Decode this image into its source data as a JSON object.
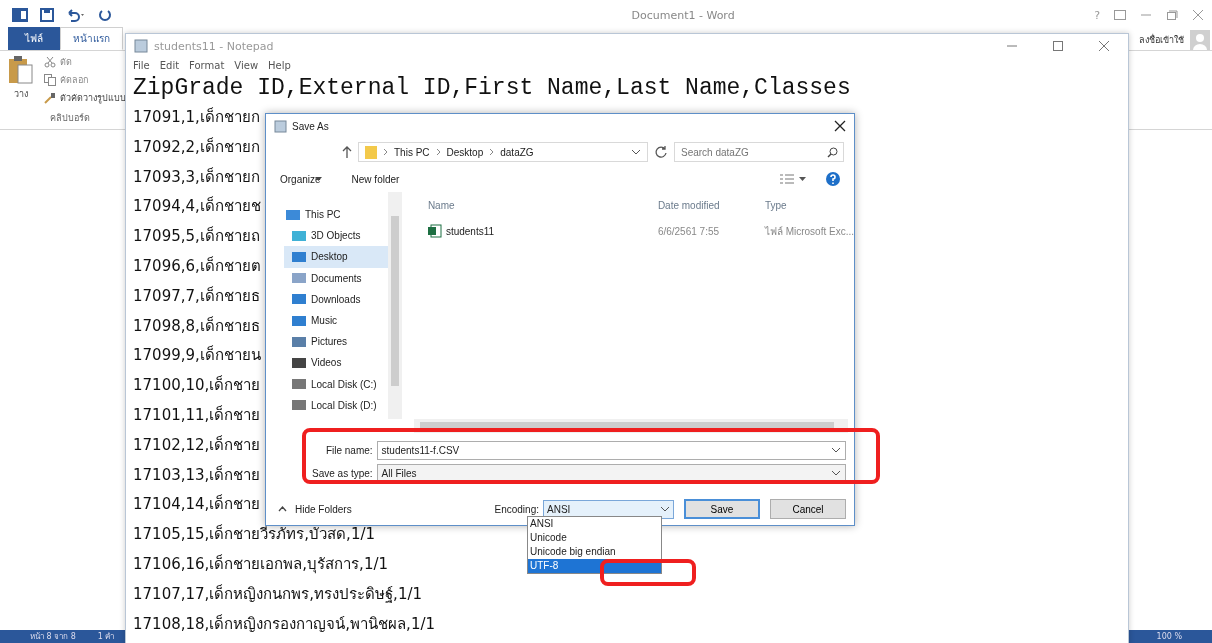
{
  "word": {
    "title": "Document1 - Word",
    "help": "?",
    "sign_in": "ลงชื่อเข้าใช้",
    "tabs": [
      {
        "label": "ไฟล์",
        "kind": "file",
        "selected": false
      },
      {
        "label": "หน้าแรก",
        "kind": "tab",
        "selected": true
      }
    ],
    "clipboard": {
      "paste": "วาง",
      "cut": "ตัด",
      "copy": "คัดลอก",
      "format_painter": "ตัวคัดวางรูปแบบ",
      "group_label": "คลิปบอร์ด"
    },
    "status_bar": {
      "page": "หน้า 8 จาก 8",
      "words": "1 คำ",
      "zoom": "100 %"
    }
  },
  "notepad": {
    "title": "students11 - Notepad",
    "menu": [
      "File",
      "Edit",
      "Format",
      "View",
      "Help"
    ],
    "header": "ZipGrade ID,External ID,First Name,Last Name,Classes",
    "lines": [
      "17091,1,เด็กชายก",
      "17092,2,เด็กชายก",
      "17093,3,เด็กชายก",
      "17094,4,เด็กชายช",
      "17095,5,เด็กชายถ",
      "17096,6,เด็กชายต",
      "17097,7,เด็กชายธ",
      "17098,8,เด็กชายธ",
      "17099,9,เด็กชายน",
      "17100,10,เด็กชาย",
      "17101,11,เด็กชาย",
      "17102,12,เด็กชาย",
      "17103,13,เด็กชาย",
      "17104,14,เด็กชาย",
      "17105,15,เด็กชายวีรภัทร,บัวสด,1/1",
      "17106,16,เด็กชายเอกพล,บุรัสการ,1/1",
      "17107,17,เด็กหญิงกนกพร,ทรงประดิษฐ์,1/1",
      "17108,18,เด็กหญิงกรองกาญจน์,พานิชผล,1/1"
    ]
  },
  "save_as": {
    "title": "Save As",
    "path": [
      "This PC",
      "Desktop",
      "dataZG"
    ],
    "search": {
      "placeholder": "Search dataZG"
    },
    "toolbar": {
      "organize": "Organize",
      "new_folder": "New folder"
    },
    "nav": [
      {
        "label": "This PC",
        "kind": "pc",
        "selected": false
      },
      {
        "label": "3D Objects",
        "kind": "objects",
        "selected": false
      },
      {
        "label": "Desktop",
        "kind": "desktop",
        "selected": true
      },
      {
        "label": "Documents",
        "kind": "documents",
        "selected": false
      },
      {
        "label": "Downloads",
        "kind": "downloads",
        "selected": false
      },
      {
        "label": "Music",
        "kind": "music",
        "selected": false
      },
      {
        "label": "Pictures",
        "kind": "pictures",
        "selected": false
      },
      {
        "label": "Videos",
        "kind": "videos",
        "selected": false
      },
      {
        "label": "Local Disk (C:)",
        "kind": "disk",
        "selected": false
      },
      {
        "label": "Local Disk (D:)",
        "kind": "disk",
        "selected": false
      }
    ],
    "columns": [
      "Name",
      "Date modified",
      "Type"
    ],
    "files": [
      {
        "name": "students11",
        "date": "6/6/2561 7:55",
        "type": "ไฟล์ Microsoft Exc..."
      }
    ],
    "file_name_label": "File name:",
    "file_name": "students11-f.CSV",
    "type_label": "Save as type:",
    "type": "All Files",
    "hide_folders": "Hide Folders",
    "encoding_label": "Encoding:",
    "encoding": "ANSI",
    "encoding_options": [
      {
        "label": "ANSI",
        "selected": false
      },
      {
        "label": "Unicode",
        "selected": false
      },
      {
        "label": "Unicode big endian",
        "selected": false
      },
      {
        "label": "UTF-8",
        "selected": true
      }
    ],
    "buttons": [
      "Save",
      "Cancel"
    ]
  }
}
